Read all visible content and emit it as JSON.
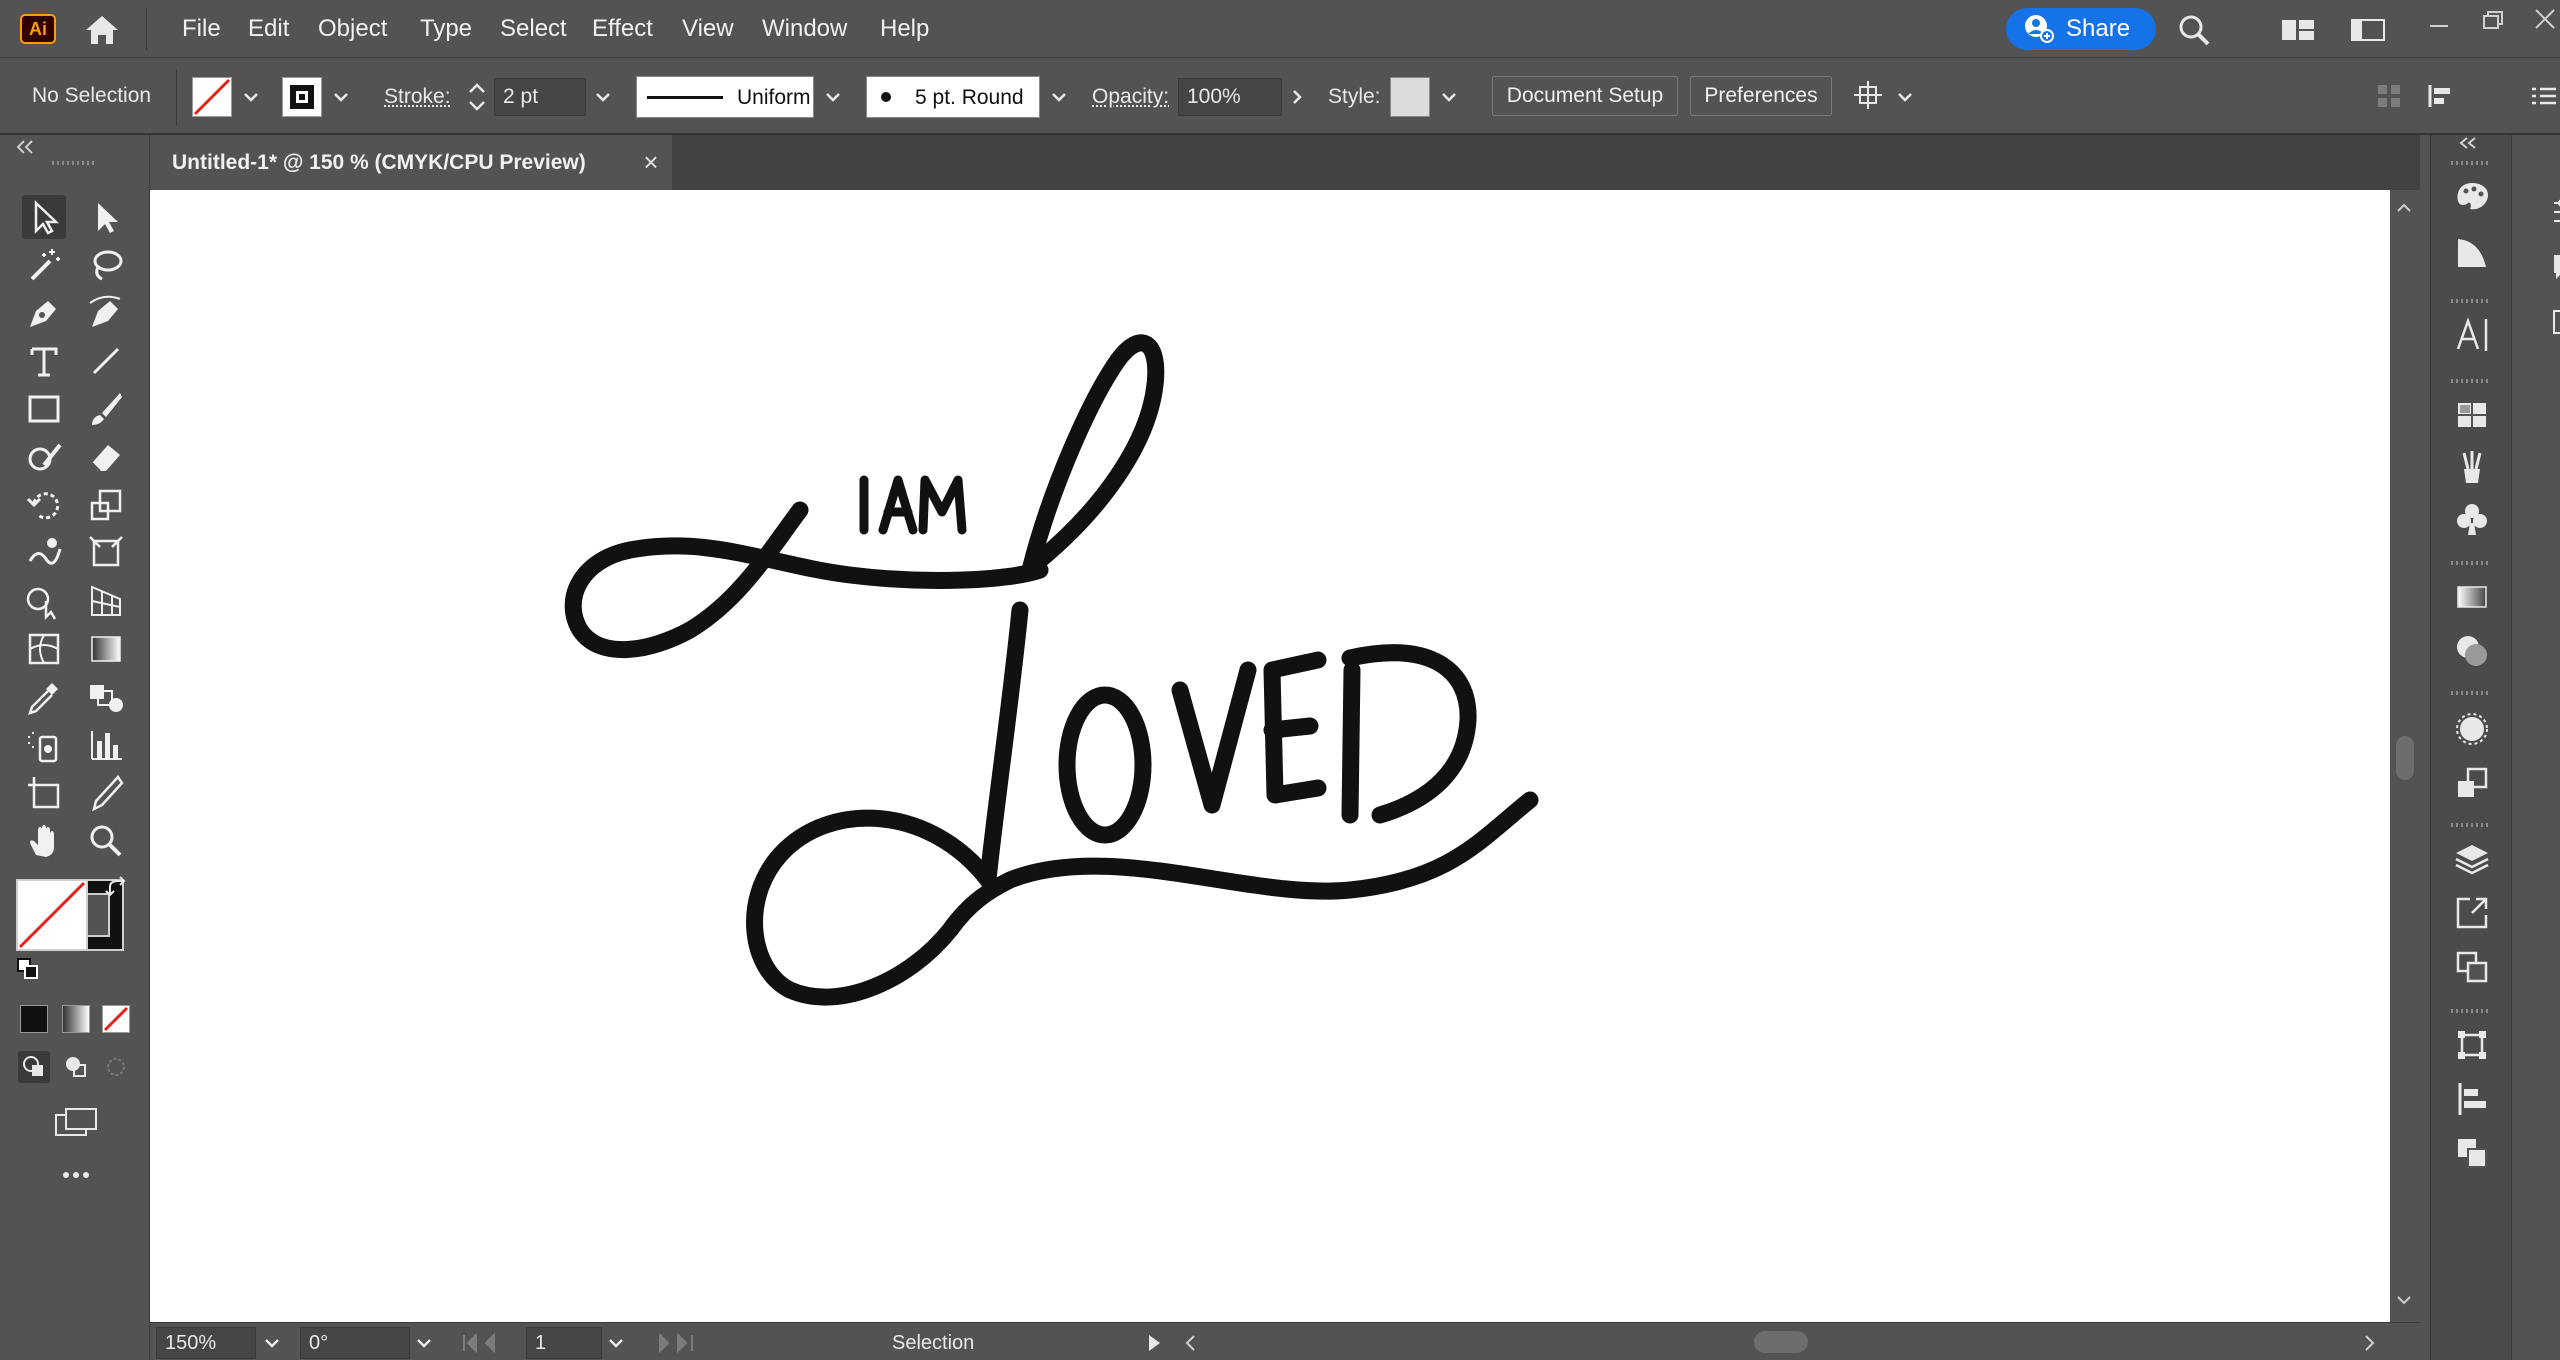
{
  "app": {
    "logo_text": "Ai",
    "menu": [
      "File",
      "Edit",
      "Object",
      "Type",
      "Select",
      "Effect",
      "View",
      "Window",
      "Help"
    ],
    "share_label": "Share"
  },
  "control_bar": {
    "selection_status": "No Selection",
    "stroke_label": "Stroke:",
    "stroke_value": "2 pt",
    "profile_value": "Uniform",
    "brush_value": "5 pt. Round",
    "opacity_label": "Opacity:",
    "opacity_value": "100%",
    "style_label": "Style:",
    "document_setup_label": "Document Setup",
    "preferences_label": "Preferences"
  },
  "document": {
    "tab_title": "Untitled-1* @ 150 % (CMYK/CPU Preview)",
    "close_glyph": "×",
    "artwork_top_text": "I AM",
    "artwork_main_text": "LOVED"
  },
  "status_bar": {
    "zoom_value": "150%",
    "rotation_value": "0°",
    "artboard_value": "1",
    "current_tool": "Selection"
  },
  "colors": {
    "ui_background": "#535353",
    "panel_dark": "#424242",
    "accent": "#1473e6",
    "canvas": "#ffffff",
    "ink": "#111111",
    "none_swatch_line": "#e2231a"
  }
}
